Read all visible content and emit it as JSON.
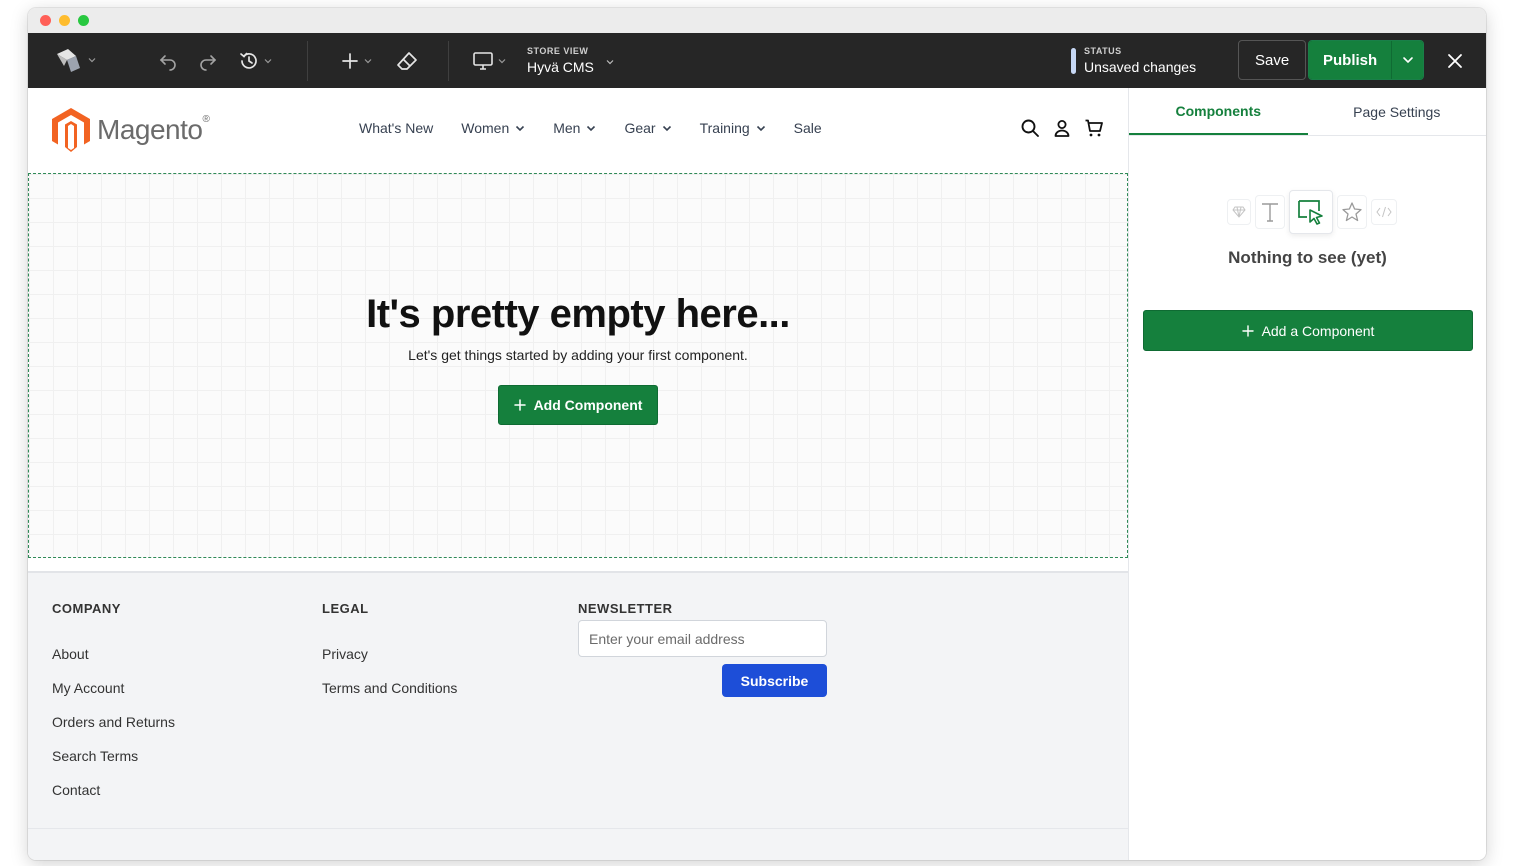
{
  "window": {
    "traffic_lights": [
      "#ff5f57",
      "#febc2e",
      "#28c840"
    ]
  },
  "toolbar": {
    "store_label": "STORE VIEW",
    "store_value": "Hyvä CMS",
    "status_label": "STATUS",
    "status_value": "Unsaved changes",
    "save_label": "Save",
    "publish_label": "Publish"
  },
  "header": {
    "logo_text": "Magento",
    "logo_mark": "®",
    "nav": [
      {
        "label": "What's New",
        "has_dropdown": false
      },
      {
        "label": "Women",
        "has_dropdown": true
      },
      {
        "label": "Men",
        "has_dropdown": true
      },
      {
        "label": "Gear",
        "has_dropdown": true
      },
      {
        "label": "Training",
        "has_dropdown": true
      },
      {
        "label": "Sale",
        "has_dropdown": false
      }
    ]
  },
  "empty_state": {
    "title": "It's pretty empty here...",
    "subtitle": "Let's get things started by adding your first component.",
    "button_label": "Add Component"
  },
  "footer": {
    "company": {
      "heading": "COMPANY",
      "links": [
        "About",
        "My Account",
        "Orders and Returns",
        "Search Terms",
        "Contact"
      ]
    },
    "legal": {
      "heading": "LEGAL",
      "links": [
        "Privacy",
        "Terms and Conditions"
      ]
    },
    "newsletter": {
      "heading": "NEWSLETTER",
      "placeholder": "Enter your email address",
      "button_label": "Subscribe"
    }
  },
  "panel": {
    "tabs": [
      {
        "label": "Components",
        "active": true
      },
      {
        "label": "Page Settings",
        "active": false
      }
    ],
    "empty_title": "Nothing to see (yet)",
    "add_button_label": "Add a Component"
  },
  "colors": {
    "accent_green": "#15803d",
    "subscribe_blue": "#1d4ed8",
    "toolbar_bg": "#262626",
    "magento_orange": "#f26322"
  }
}
